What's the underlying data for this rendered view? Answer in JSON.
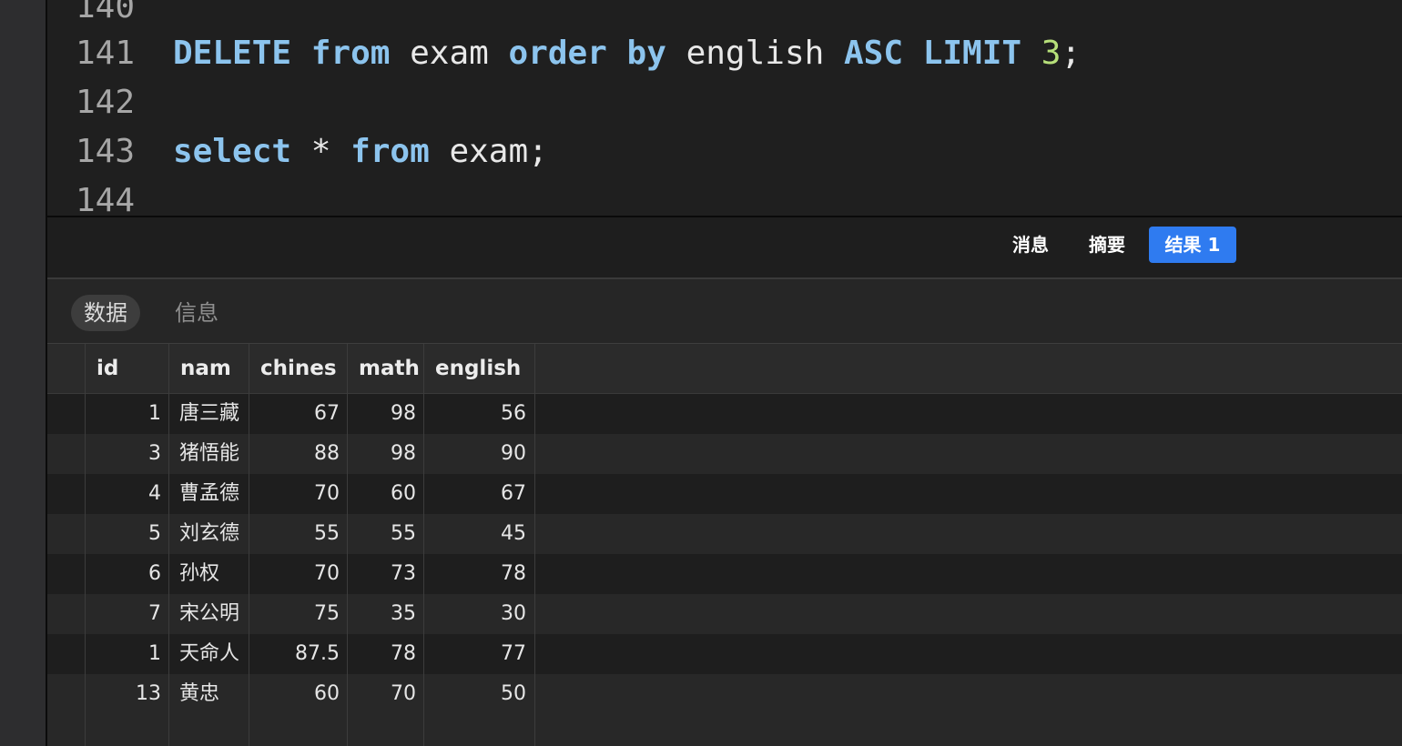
{
  "editor": {
    "lines": [
      {
        "number": "140",
        "tokens": []
      },
      {
        "number": "141",
        "tokens": [
          {
            "t": "DELETE",
            "k": "kw"
          },
          {
            "t": " ",
            "k": "id"
          },
          {
            "t": "from",
            "k": "kw"
          },
          {
            "t": " exam ",
            "k": "id"
          },
          {
            "t": "order",
            "k": "kw"
          },
          {
            "t": " ",
            "k": "id"
          },
          {
            "t": "by",
            "k": "kw"
          },
          {
            "t": " english ",
            "k": "id"
          },
          {
            "t": "ASC",
            "k": "kw"
          },
          {
            "t": " ",
            "k": "id"
          },
          {
            "t": "LIMIT",
            "k": "kw"
          },
          {
            "t": " ",
            "k": "id"
          },
          {
            "t": "3",
            "k": "num"
          },
          {
            "t": ";",
            "k": "id"
          }
        ]
      },
      {
        "number": "142",
        "tokens": []
      },
      {
        "number": "143",
        "tokens": [
          {
            "t": "select",
            "k": "kw"
          },
          {
            "t": " * ",
            "k": "id"
          },
          {
            "t": "from",
            "k": "kw"
          },
          {
            "t": " exam;",
            "k": "id"
          }
        ]
      },
      {
        "number": "144",
        "tokens": []
      }
    ]
  },
  "result_tabs": [
    {
      "label": "消息",
      "active": false
    },
    {
      "label": "摘要",
      "active": false
    },
    {
      "label": "结果 1",
      "active": true
    }
  ],
  "sub_tabs": [
    {
      "label": "数据",
      "active": true
    },
    {
      "label": "信息",
      "active": false
    }
  ],
  "table": {
    "columns": [
      "id",
      "nam",
      "chines",
      "math",
      "english"
    ],
    "rows": [
      [
        "1",
        "唐三藏",
        "67",
        "98",
        "56"
      ],
      [
        "3",
        "猪悟能",
        "88",
        "98",
        "90"
      ],
      [
        "4",
        "曹孟德",
        "70",
        "60",
        "67"
      ],
      [
        "5",
        "刘玄德",
        "55",
        "55",
        "45"
      ],
      [
        "6",
        "孙权",
        "70",
        "73",
        "78"
      ],
      [
        "7",
        "宋公明",
        "75",
        "35",
        "30"
      ],
      [
        "1",
        "天命人",
        "87.5",
        "78",
        "77"
      ],
      [
        "13",
        "黄忠",
        "60",
        "70",
        "50"
      ]
    ]
  },
  "colors": {
    "keyword": "#8cc4ee",
    "number": "#b7e07a",
    "active_tab": "#2f7bf0"
  }
}
